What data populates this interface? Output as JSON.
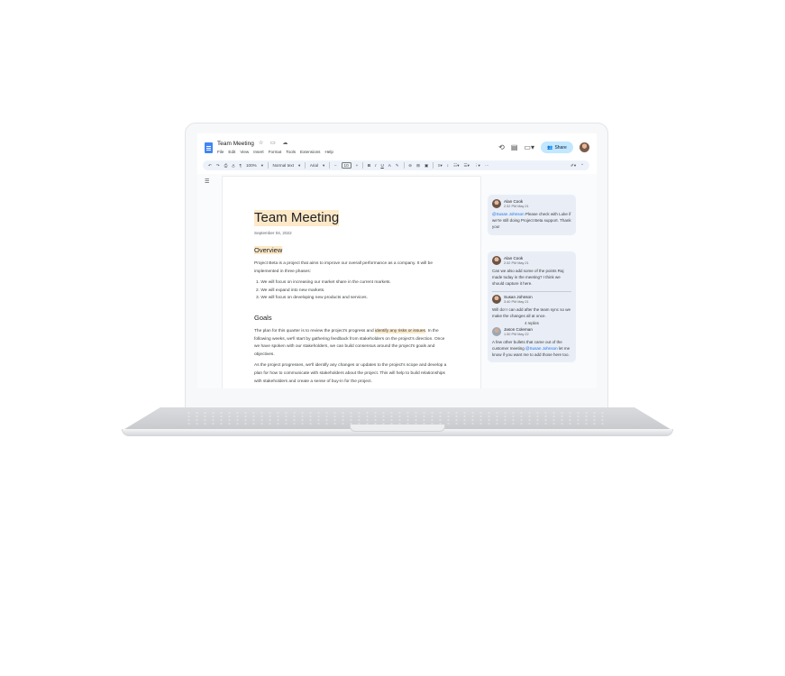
{
  "doc": {
    "title": "Team Meeting",
    "title_icons": "☆ ▭ ☁",
    "menu": [
      "File",
      "Edit",
      "View",
      "Insert",
      "Format",
      "Tools",
      "Extensions",
      "Help"
    ],
    "share_label": "Share"
  },
  "toolbar": {
    "zoom": "100%",
    "style": "Normal text",
    "font": "Arial",
    "size": "10"
  },
  "page": {
    "heading": "Team Meeting",
    "date": "September 04, 2022",
    "overview_heading": "Overview",
    "overview_text": "Project Beta is a project that aims to improve our overall performance as a company. It will be implemented in three phases:",
    "list": [
      "We will focus on increasing our market share in the current markets.",
      "We will expand into new markets.",
      "We will focus on developing new products and services."
    ],
    "goals_heading": "Goals",
    "goals_p1_a": "The plan for this quarter is to review the project's progress and ",
    "goals_p1_hl": "identify any risks or issues",
    "goals_p1_b": ". In the following weeks, we'll start by gathering feedback from stakeholders on the project's direction. Once we have spoken with our stakeholders, we can build consensus around the project's goals and objectives.",
    "goals_p2": "As the project progresses, we'll identify any changes or updates to the project's scope and develop a plan for how to communicate with stakeholders about the project. This will help to build relationships with stakeholders and create a sense of buy-in for the project."
  },
  "comments": {
    "c1": {
      "name": "Alan Cook",
      "time": "2:32 PM May 21",
      "mention": "@Susan Johnson",
      "body": " Please check with Luke if we're still doing Project Beta support. Thank you!"
    },
    "c2": {
      "name": "Alan Cook",
      "time": "2:32 PM May 21",
      "body": "Can we also add some of the points Raj made today in the meeting? I think we should capture it here."
    },
    "c3": {
      "name": "Susan Johnson",
      "time": "3:40 PM May 21",
      "body": "Will do! I can add after the team sync so we make the changes all at once."
    },
    "replies": "4 replies",
    "c4": {
      "name": "Jason Coleman",
      "time": "1:30 PM May 22",
      "body_a": "A few other bullets that came out of the customer meeting ",
      "mention": "@Susan Johnson",
      "body_b": " let me know if you want me to add those here too."
    }
  }
}
